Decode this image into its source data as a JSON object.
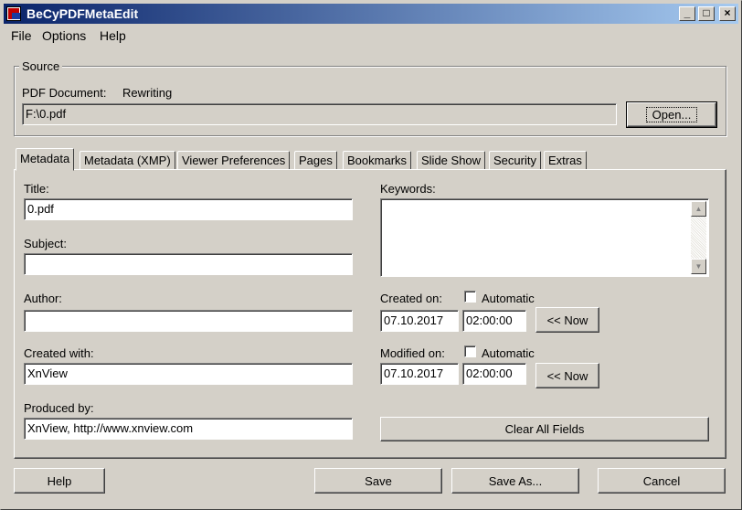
{
  "window": {
    "title": "BeCyPDFMetaEdit"
  },
  "menu": [
    "File",
    "Options",
    "Help"
  ],
  "source": {
    "group_label": "Source",
    "pdf_document_label": "PDF Document:",
    "mode": "Rewriting",
    "file_path": "F:\\0.pdf",
    "open_label": "Open..."
  },
  "tabs": [
    "Metadata",
    "Metadata (XMP)",
    "Viewer Preferences",
    "Pages",
    "Bookmarks",
    "Slide Show",
    "Security",
    "Extras"
  ],
  "metadata": {
    "title_label": "Title:",
    "title_value": "0.pdf",
    "subject_label": "Subject:",
    "subject_value": "",
    "author_label": "Author:",
    "author_value": "",
    "created_with_label": "Created with:",
    "created_with_value": "XnView",
    "produced_by_label": "Produced by:",
    "produced_by_value": "XnView, http://www.xnview.com",
    "keywords_label": "Keywords:",
    "keywords_value": "",
    "created_on_label": "Created on:",
    "created_automatic_label": "Automatic",
    "created_automatic_checked": false,
    "created_date": "07.10.2017",
    "created_time": "02:00:00",
    "created_now_label": "<< Now",
    "modified_on_label": "Modified on:",
    "modified_automatic_label": "Automatic",
    "modified_automatic_checked": false,
    "modified_date": "07.10.2017",
    "modified_time": "02:00:00",
    "modified_now_label": "<< Now",
    "clear_all_label": "Clear All Fields"
  },
  "footer": {
    "help_label": "Help",
    "save_label": "Save",
    "save_as_label": "Save As...",
    "cancel_label": "Cancel"
  }
}
